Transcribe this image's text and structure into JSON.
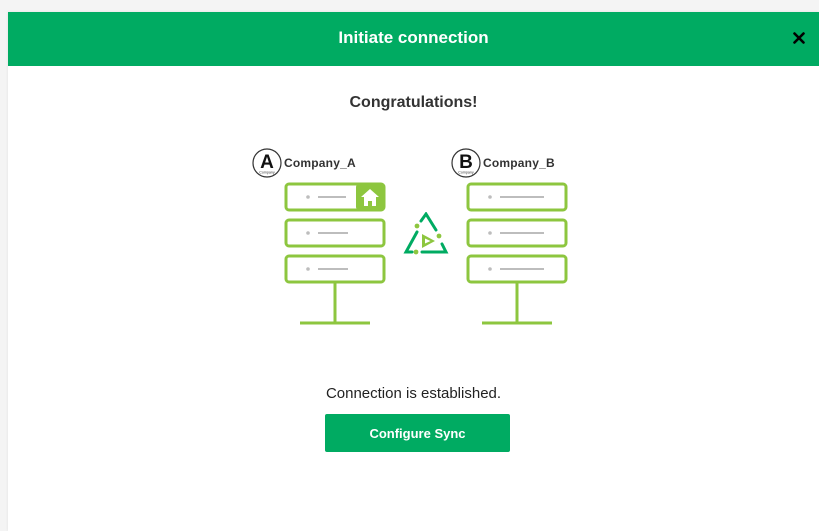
{
  "header": {
    "title": "Initiate connection",
    "close_icon": "close-icon"
  },
  "main": {
    "headline": "Congratulations!",
    "status": "Connection is established.",
    "configure_button_label": "Configure Sync"
  },
  "illustration": {
    "company_a": {
      "badge_letter": "A",
      "badge_caption": "Company",
      "name": "Company_A",
      "icon": "server-stack-icon",
      "home_icon": "home-icon"
    },
    "company_b": {
      "badge_letter": "B",
      "badge_caption": "Company",
      "name": "Company_B",
      "icon": "server-stack-icon"
    },
    "connector_icon": "sync-triangle-icon"
  },
  "colors": {
    "brand_green": "#00ab62",
    "illustration_green": "#8dc63f",
    "text": "#333333"
  }
}
